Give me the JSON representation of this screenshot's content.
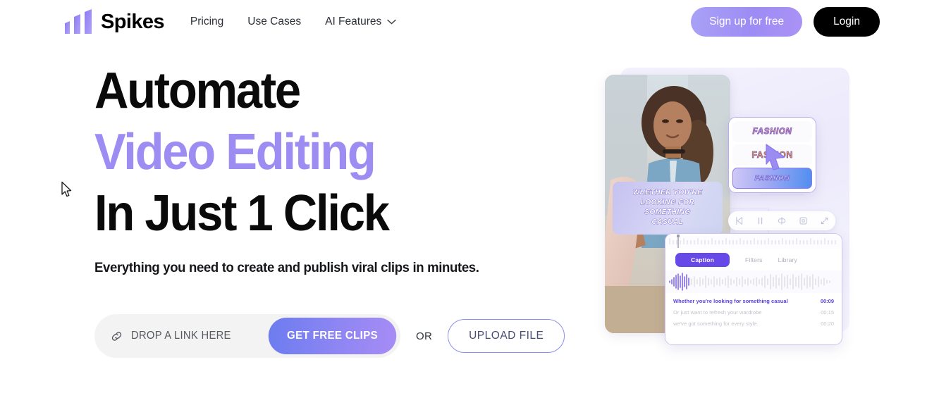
{
  "brand": {
    "name": "Spikes",
    "logo_icon": "spikes-bars-logo"
  },
  "nav": {
    "links": [
      {
        "label": "Pricing",
        "has_dropdown": false
      },
      {
        "label": "Use Cases",
        "has_dropdown": false
      },
      {
        "label": "AI Features",
        "has_dropdown": true,
        "dropdown_icon": "chevron-down-icon"
      }
    ],
    "signup_label": "Sign up for free",
    "login_label": "Login"
  },
  "hero": {
    "headline_line1": "Automate",
    "headline_line2": "Video Editing",
    "headline_line3": "In Just 1 Click",
    "subhead": "Everything you need to create and publish viral clips in minutes.",
    "accent_color": "#9d8df3"
  },
  "cta": {
    "link_icon": "link-chain-icon",
    "link_placeholder": "DROP A LINK HERE",
    "link_value": "",
    "get_clips_label": "GET FREE CLIPS",
    "or_label": "OR",
    "upload_label": "UPLOAD FILE"
  },
  "app_mock": {
    "video_caption_lines": [
      "WHETHER YOU'RE",
      "LOOKING FOR",
      "SOMETHING",
      "CASUAL"
    ],
    "style_picker": {
      "options": [
        {
          "label": "FASHION",
          "style": "yellow-outline",
          "selected": false
        },
        {
          "label": "FASHION",
          "style": "orange-bold",
          "selected": false
        },
        {
          "label": "FASHION",
          "style": "italic-gradient",
          "selected": true
        }
      ],
      "cursor_icon": "pointer-cursor-icon"
    },
    "playback_controls": [
      {
        "icon": "skip-back-icon"
      },
      {
        "icon": "pause-icon"
      },
      {
        "icon": "loop-icon"
      },
      {
        "icon": "crop-frame-icon"
      },
      {
        "icon": "expand-icon"
      }
    ],
    "editor": {
      "tabs": [
        {
          "label": "Caption",
          "active": true
        },
        {
          "label": "Filters",
          "active": false
        },
        {
          "label": "Library",
          "active": false
        }
      ],
      "transcript": [
        {
          "text": "Whether you're looking for something casual",
          "time": "00:09",
          "active": true
        },
        {
          "text": "Or just want to refresh your wardrobe",
          "time": "00:15",
          "active": false
        },
        {
          "text": "we've got something for every style.",
          "time": "00:20",
          "active": false
        }
      ]
    }
  },
  "cursor": {
    "icon": "mouse-arrow-cursor"
  }
}
